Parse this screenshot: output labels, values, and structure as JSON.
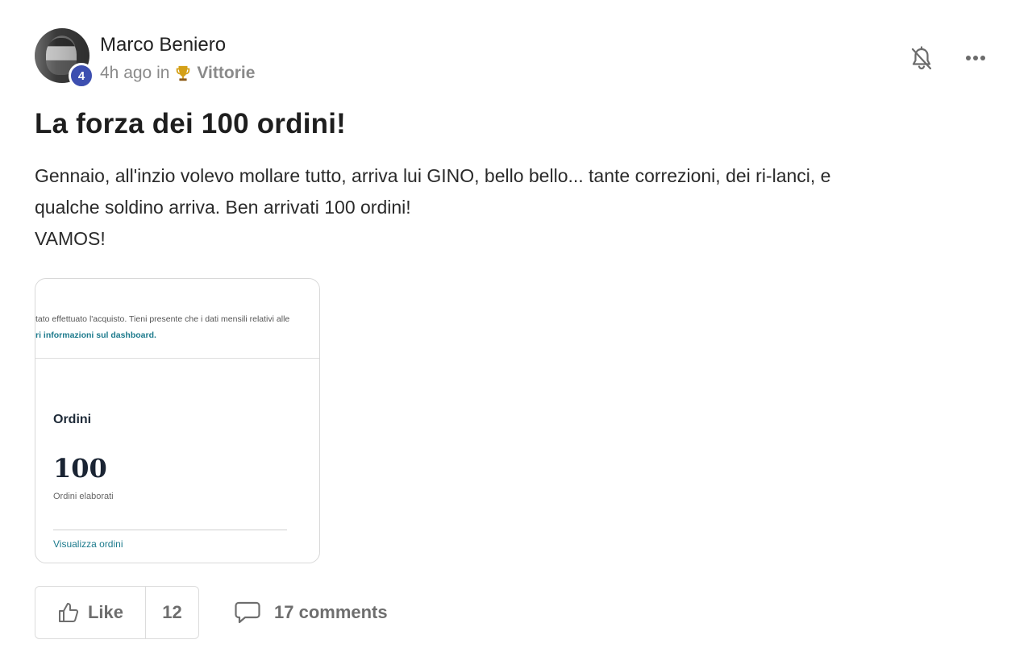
{
  "post": {
    "author": {
      "name": "Marco Beniero",
      "level": "4",
      "avatar_icon": "avatar-photo"
    },
    "meta": {
      "time_ago": "4h ago in",
      "category_icon": "trophy-icon",
      "category": "Vittorie"
    },
    "actions": {
      "notify_icon": "bell-off-icon",
      "more_icon": "more-horizontal-icon"
    },
    "title": "La forza dei 100 ordini!",
    "body_lines": [
      "Gennaio, all'inzio volevo mollare tutto, arriva lui GINO, bello bello... tante correzioni, dei ri-lanci, e",
      "qualche soldino arriva. Ben arrivati 100 ordini!",
      "VAMOS!"
    ],
    "attachment": {
      "note_text": "tato effettuato l'acquisto. Tieni presente che i dati mensili relativi alle",
      "note_link": "ri informazioni sul dashboard.",
      "heading": "Ordini",
      "number": "100",
      "caption": "Ordini elaborati",
      "view_link": "Visualizza ordini"
    },
    "footer": {
      "like_label": "Like",
      "like_count": "12",
      "comments_label": "17 comments"
    }
  },
  "colors": {
    "badge": "#3d4fb0",
    "link": "#1c7a8c",
    "muted": "#8a8a8a"
  }
}
